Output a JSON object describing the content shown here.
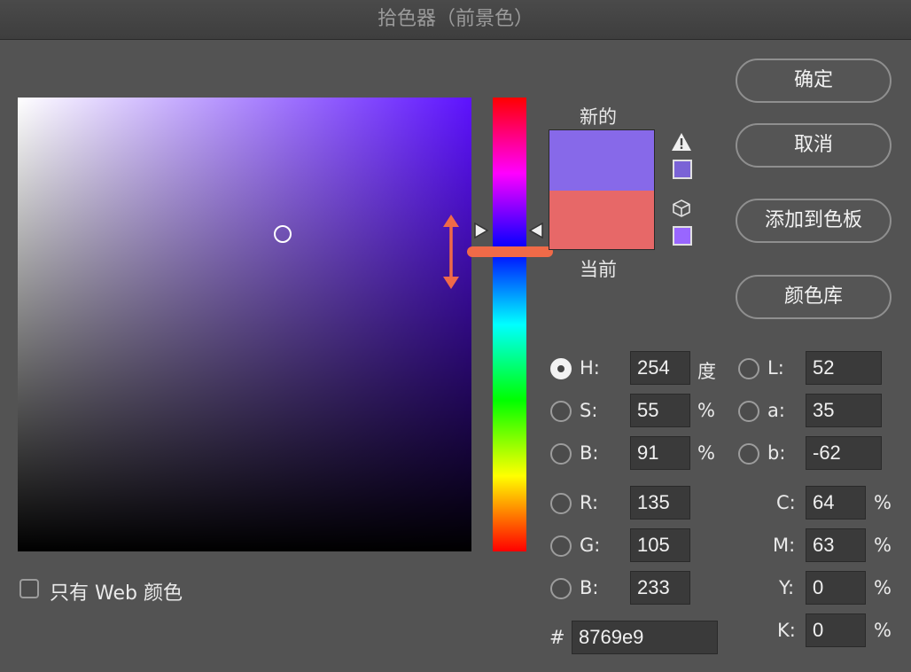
{
  "window": {
    "title": "拾色器（前景色）"
  },
  "swatch": {
    "new_label": "新的",
    "current_label": "当前",
    "new_color": "#8769e9",
    "current_color": "#e76868"
  },
  "buttons": {
    "ok": "确定",
    "cancel": "取消",
    "add_to_swatches": "添加到色板",
    "color_libraries": "颜色库"
  },
  "hsb": {
    "h": {
      "label": "H:",
      "value": "254",
      "unit": "度",
      "selected": true
    },
    "s": {
      "label": "S:",
      "value": "55",
      "unit": "%"
    },
    "b": {
      "label": "B:",
      "value": "91",
      "unit": "%"
    }
  },
  "lab": {
    "l": {
      "label": "L:",
      "value": "52"
    },
    "a": {
      "label": "a:",
      "value": "35"
    },
    "b": {
      "label": "b:",
      "value": "-62"
    }
  },
  "rgb": {
    "r": {
      "label": "R:",
      "value": "135"
    },
    "g": {
      "label": "G:",
      "value": "105"
    },
    "b": {
      "label": "B:",
      "value": "233"
    }
  },
  "cmyk": {
    "c": {
      "label": "C:",
      "value": "64",
      "unit": "%"
    },
    "m": {
      "label": "M:",
      "value": "63",
      "unit": "%"
    },
    "y": {
      "label": "Y:",
      "value": "0",
      "unit": "%"
    },
    "k": {
      "label": "K:",
      "value": "0",
      "unit": "%"
    }
  },
  "hex": {
    "label": "#",
    "value": "8769e9"
  },
  "web_only": {
    "label": "只有 Web 颜色",
    "checked": false
  },
  "icons": {
    "gamut_warning": "warning-triangle-icon",
    "web_safe": "cube-icon",
    "gamut_swatch_color": "#7a63d6",
    "web_swatch_color": "#9966ff"
  },
  "colors": {
    "accent_annotation": "#f06a48",
    "hue_field_color": "#5d12ff"
  }
}
